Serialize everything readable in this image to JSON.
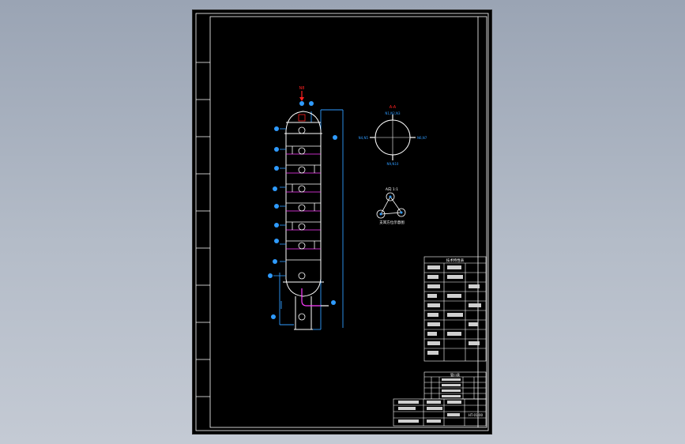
{
  "drawing": {
    "background": "#000000",
    "frame_color": "#ffffff",
    "vessel_color": "#ffffff",
    "piping_color": "#2f9bff",
    "tray_color": "#ff3cff",
    "accent_color": "#ff2020",
    "label_color": "#2f9bff",
    "top_nozzle_label": "N8",
    "plan_view_label": "A-A",
    "plan_nozzle_labels": [
      "N1,N2,N3",
      "N4,N5",
      "N6,N7",
      "N9,N10"
    ],
    "support_view_label": "A向 1:1",
    "support_view_caption": "支耳方位示意图",
    "technical_table_title": "技术特性表",
    "nozzle_table_title": "管口表",
    "title_block_drawing_no": "HT-01-00"
  }
}
